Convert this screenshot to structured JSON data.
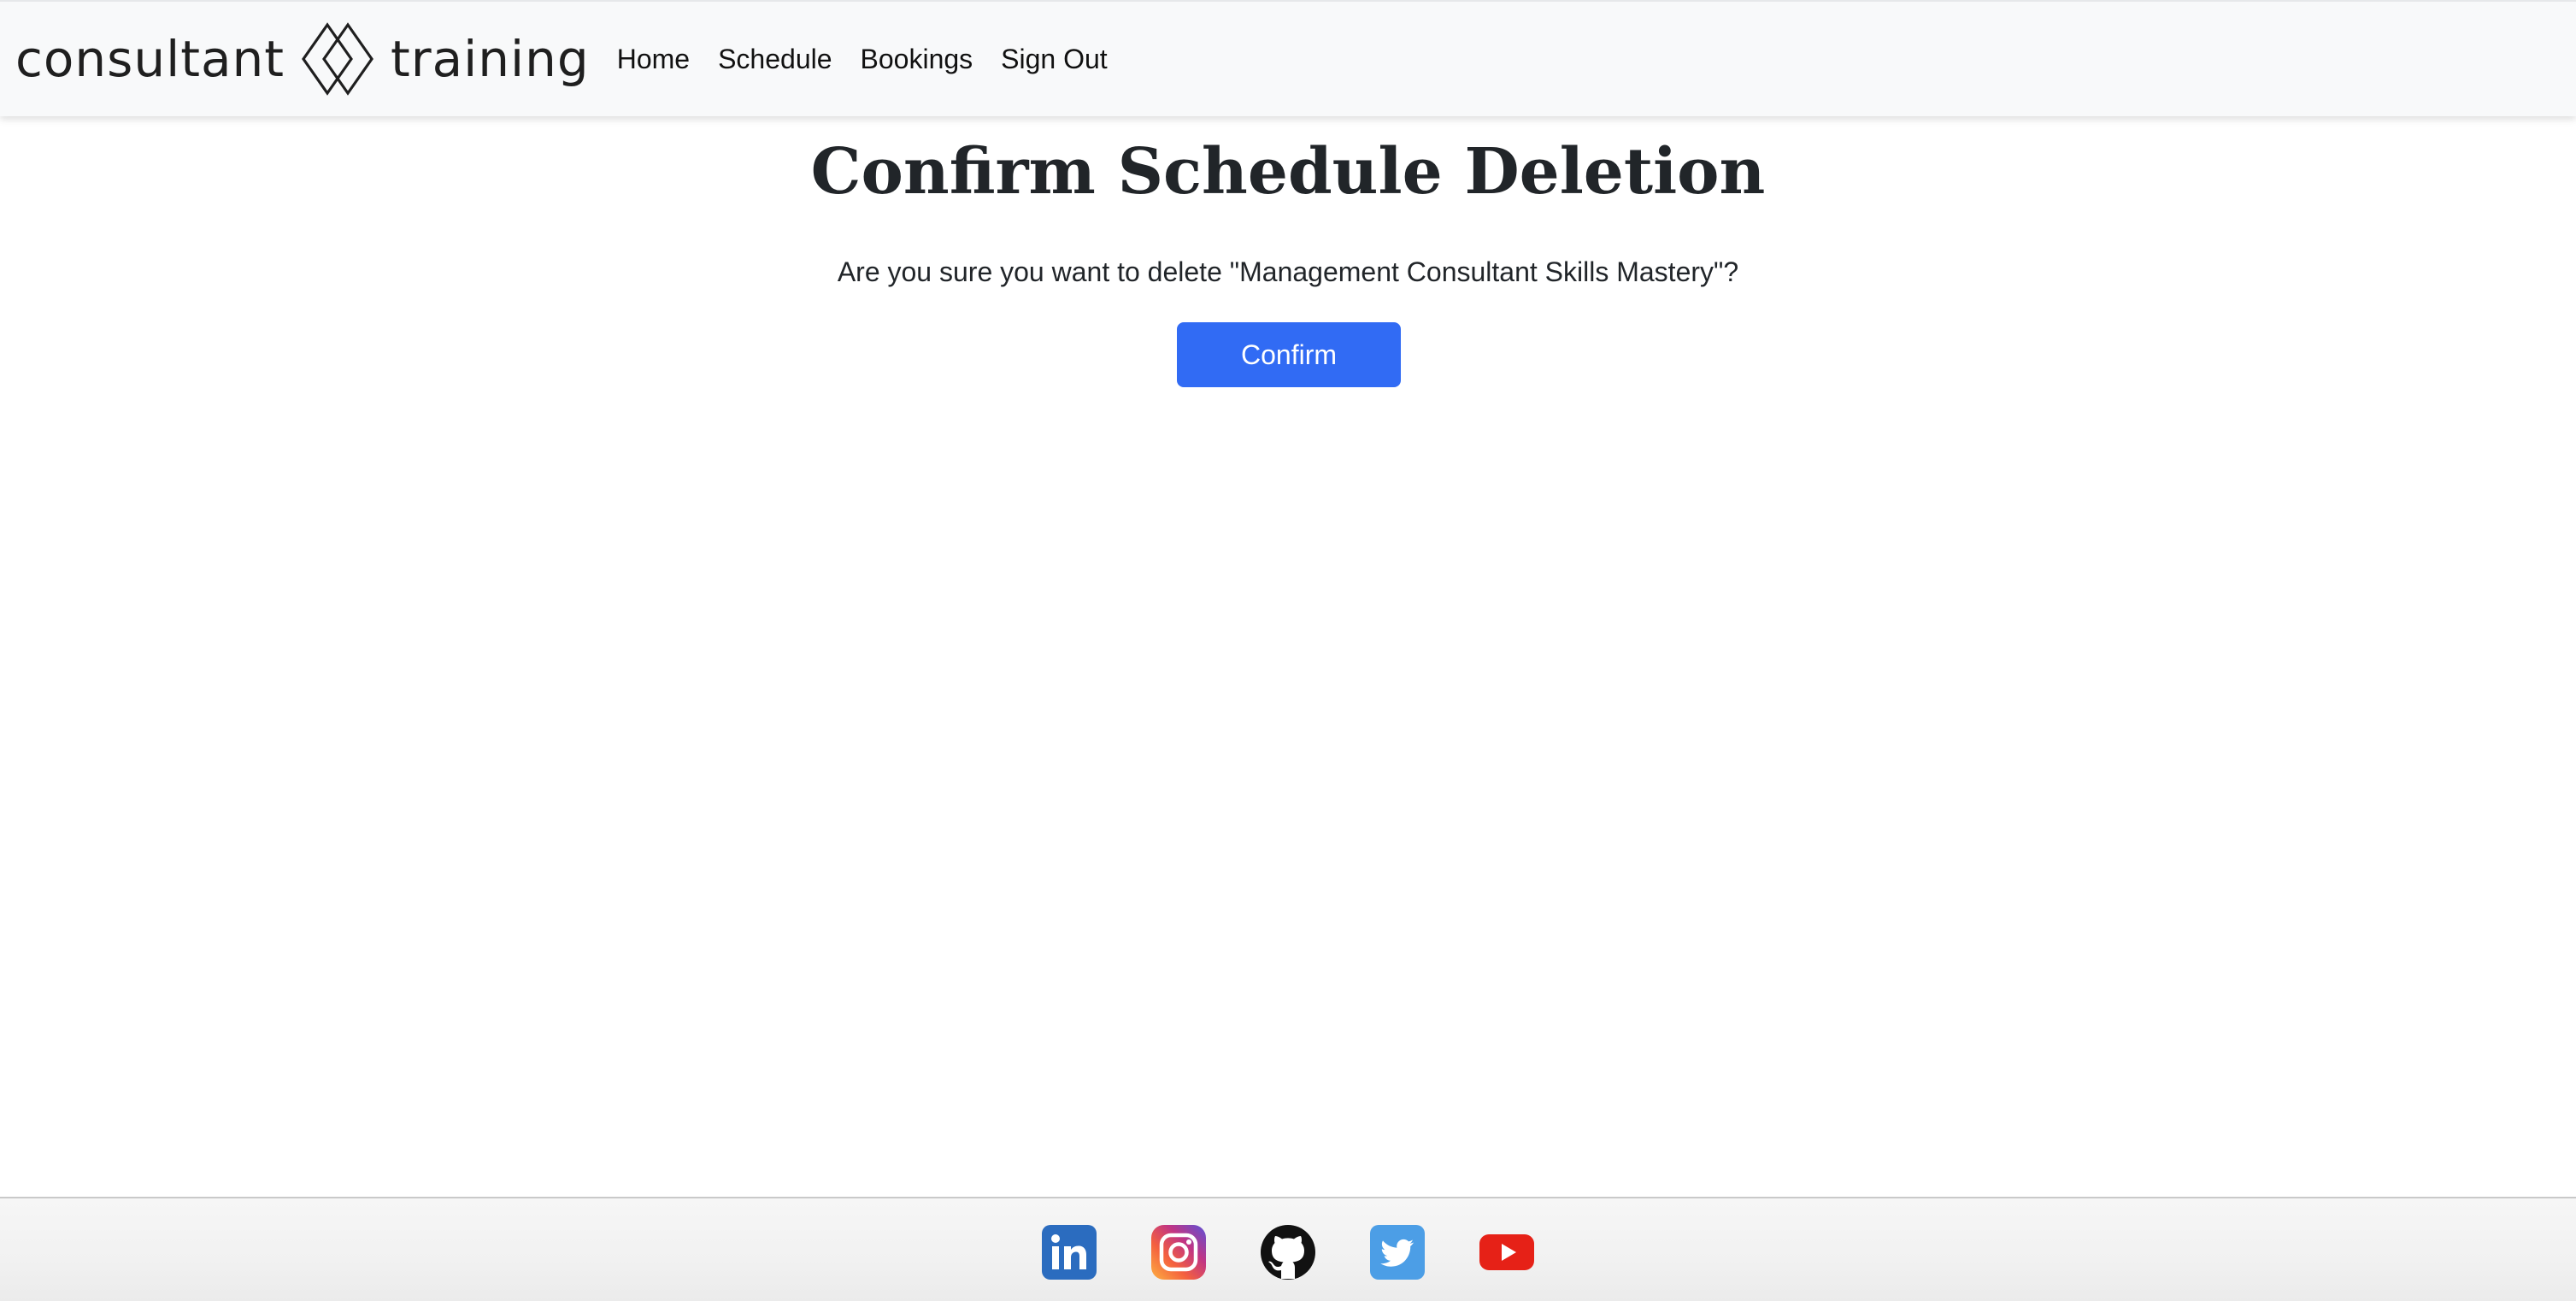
{
  "brand": {
    "word_left": "consultant",
    "word_right": "training",
    "logo_icon": "double-diamond-logo-icon"
  },
  "nav": {
    "items": [
      {
        "label": "Home"
      },
      {
        "label": "Schedule"
      },
      {
        "label": "Bookings"
      },
      {
        "label": "Sign Out"
      }
    ]
  },
  "main": {
    "title": "Confirm Schedule Deletion",
    "message": "Are you sure you want to delete \"Management Consultant Skills Mastery\"?",
    "confirm_label": "Confirm"
  },
  "footer": {
    "social": [
      {
        "icon": "linkedin-icon",
        "color": "#2b6cbf"
      },
      {
        "icon": "instagram-icon",
        "color": "#c13584"
      },
      {
        "icon": "github-icon",
        "color": "#111111"
      },
      {
        "icon": "twitter-icon",
        "color": "#4c9ee6"
      },
      {
        "icon": "youtube-icon",
        "color": "#e62117"
      }
    ]
  },
  "colors": {
    "accent": "#316bf4",
    "navbar_bg": "#f8f9fa",
    "text": "#212529"
  }
}
